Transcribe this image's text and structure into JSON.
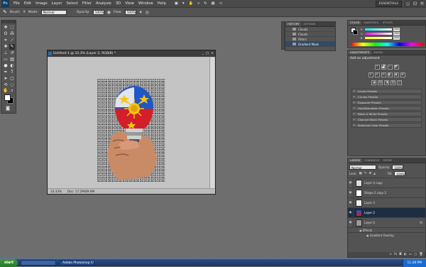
{
  "menubar": {
    "logo": "Ps",
    "items": [
      "File",
      "Edit",
      "Image",
      "Layer",
      "Select",
      "Filter",
      "Analysis",
      "3D",
      "View",
      "Window",
      "Help"
    ],
    "workspace": "ESSENTIALS"
  },
  "options": {
    "brush_label": "Brush:",
    "brush_size": "9",
    "mode_label": "Mode:",
    "mode_value": "Normal",
    "opacity_label": "Opacity:",
    "opacity_value": "100%",
    "flow_label": "Flow:",
    "flow_value": "100%"
  },
  "document": {
    "title": "Untitled-1 @ 33.3% (Layer 2, RGB/8) *",
    "zoom": "33.33%",
    "doc_info": "Doc: 17.2M/89.9M"
  },
  "history": {
    "tabs": [
      "HISTORY",
      "ACTIONS"
    ],
    "items": [
      "Clouds",
      "Clouds",
      "Filters",
      "Gradient Mask"
    ]
  },
  "color": {
    "tabs": [
      "COLOR",
      "SWATCHES",
      "STYLES"
    ],
    "channels": [
      {
        "label": "R",
        "value": "255"
      },
      {
        "label": "G",
        "value": "255"
      },
      {
        "label": "B",
        "value": "255"
      }
    ]
  },
  "adjustments": {
    "tabs": [
      "ADJUSTMENTS",
      "MASKS"
    ],
    "heading": "Add an adjustment",
    "presets": [
      "Levels Presets",
      "Curves Presets",
      "Exposure Presets",
      "Hue/Saturation Presets",
      "Black & White Presets",
      "Channel Mixer Presets",
      "Selective Color Presets"
    ]
  },
  "layers": {
    "tabs": [
      "LAYERS",
      "CHANNELS",
      "PATHS"
    ],
    "blend_mode": "Normal",
    "opacity_label": "Opacity:",
    "opacity_value": "100%",
    "lock_label": "Lock:",
    "fill_label": "Fill:",
    "fill_value": "100%",
    "items": [
      {
        "name": "Layer 4 copy"
      },
      {
        "name": "Shape 2 copy 2"
      },
      {
        "name": "Layer 3"
      },
      {
        "name": "Layer 2"
      },
      {
        "name": "Layer 0"
      }
    ],
    "effects_label": "Effects",
    "effect_name": "Gradient Overlay"
  },
  "taskbar": {
    "start": "start",
    "task_1": "",
    "task_2": "Adobe Photoshop CS4",
    "clock": "11:28 PM"
  },
  "colors": {
    "selected_layer": "#1e2e42",
    "history_selected": "#2f4a66",
    "taskbar": "#2b4e84",
    "bulb_blue": "#1f57c8",
    "bulb_red": "#d21f2a",
    "sun_yellow": "#f5c518"
  }
}
